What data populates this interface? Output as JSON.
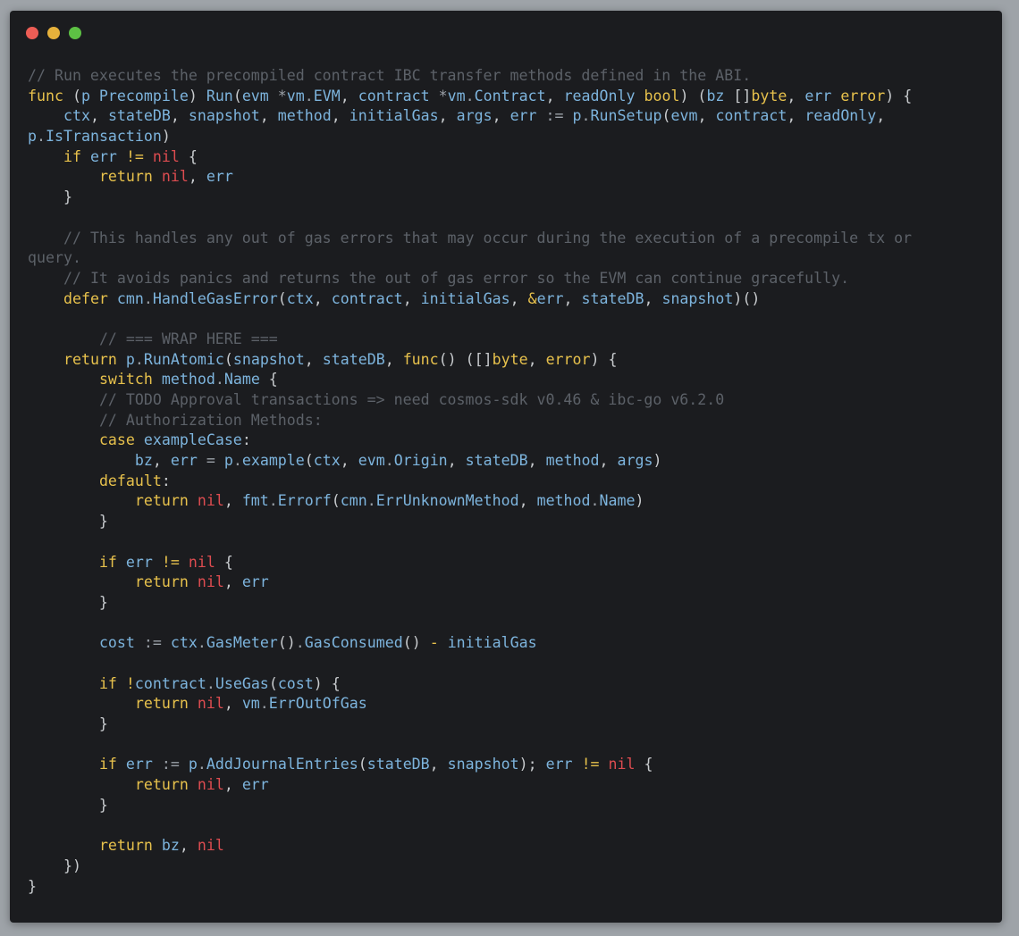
{
  "window": {
    "controls": [
      {
        "name": "close",
        "color": "#ed5d55"
      },
      {
        "name": "minimize",
        "color": "#e6b13b"
      },
      {
        "name": "zoom",
        "color": "#5dc144"
      }
    ]
  },
  "palette": {
    "c": "#5c6168",
    "k": "#e7c14c",
    "i": "#7db4dd",
    "o": "#9ba1a8",
    "n": "#dd4c50",
    "t": "#e7c14c",
    "s": "#c8cbce"
  },
  "code": {
    "lines": [
      [
        [
          "c",
          "// Run executes the precompiled contract IBC transfer methods defined in the ABI."
        ]
      ],
      [
        [
          "k",
          "func"
        ],
        [
          "s",
          " ("
        ],
        [
          "i",
          "p Precompile"
        ],
        [
          "s",
          ") "
        ],
        [
          "i",
          "Run"
        ],
        [
          "s",
          "("
        ],
        [
          "i",
          "evm "
        ],
        [
          "o",
          "*"
        ],
        [
          "i",
          "vm"
        ],
        [
          "o",
          "."
        ],
        [
          "i",
          "EVM"
        ],
        [
          "s",
          ", "
        ],
        [
          "i",
          "contract "
        ],
        [
          "o",
          "*"
        ],
        [
          "i",
          "vm"
        ],
        [
          "o",
          "."
        ],
        [
          "i",
          "Contract"
        ],
        [
          "s",
          ", "
        ],
        [
          "i",
          "readOnly "
        ],
        [
          "k",
          "bool"
        ],
        [
          "s",
          ") ("
        ],
        [
          "i",
          "bz "
        ],
        [
          "s",
          "[]"
        ],
        [
          "k",
          "byte"
        ],
        [
          "s",
          ", "
        ],
        [
          "i",
          "err "
        ],
        [
          "k",
          "error"
        ],
        [
          "s",
          ") {"
        ]
      ],
      [
        [
          "s",
          "    "
        ],
        [
          "i",
          "ctx"
        ],
        [
          "s",
          ", "
        ],
        [
          "i",
          "stateDB"
        ],
        [
          "s",
          ", "
        ],
        [
          "i",
          "snapshot"
        ],
        [
          "s",
          ", "
        ],
        [
          "i",
          "method"
        ],
        [
          "s",
          ", "
        ],
        [
          "i",
          "initialGas"
        ],
        [
          "s",
          ", "
        ],
        [
          "i",
          "args"
        ],
        [
          "s",
          ", "
        ],
        [
          "i",
          "err"
        ],
        [
          "s",
          " "
        ],
        [
          "o",
          ":="
        ],
        [
          "s",
          " "
        ],
        [
          "i",
          "p"
        ],
        [
          "o",
          "."
        ],
        [
          "i",
          "RunSetup"
        ],
        [
          "s",
          "("
        ],
        [
          "i",
          "evm"
        ],
        [
          "s",
          ", "
        ],
        [
          "i",
          "contract"
        ],
        [
          "s",
          ", "
        ],
        [
          "i",
          "readOnly"
        ],
        [
          "s",
          ","
        ]
      ],
      [
        [
          "i",
          "p"
        ],
        [
          "o",
          "."
        ],
        [
          "i",
          "IsTransaction"
        ],
        [
          "s",
          ")"
        ]
      ],
      [
        [
          "s",
          "    "
        ],
        [
          "k",
          "if"
        ],
        [
          "s",
          " "
        ],
        [
          "i",
          "err"
        ],
        [
          "s",
          " "
        ],
        [
          "t",
          "!="
        ],
        [
          "s",
          " "
        ],
        [
          "n",
          "nil"
        ],
        [
          "s",
          " {"
        ]
      ],
      [
        [
          "s",
          "        "
        ],
        [
          "k",
          "return"
        ],
        [
          "s",
          " "
        ],
        [
          "n",
          "nil"
        ],
        [
          "s",
          ", "
        ],
        [
          "i",
          "err"
        ]
      ],
      [
        [
          "s",
          "    }"
        ]
      ],
      [],
      [
        [
          "s",
          "    "
        ],
        [
          "c",
          "// This handles any out of gas errors that may occur during the execution of a precompile tx or"
        ]
      ],
      [
        [
          "c",
          "query."
        ]
      ],
      [
        [
          "s",
          "    "
        ],
        [
          "c",
          "// It avoids panics and returns the out of gas error so the EVM can continue gracefully."
        ]
      ],
      [
        [
          "s",
          "    "
        ],
        [
          "k",
          "defer"
        ],
        [
          "s",
          " "
        ],
        [
          "i",
          "cmn"
        ],
        [
          "o",
          "."
        ],
        [
          "i",
          "HandleGasError"
        ],
        [
          "s",
          "("
        ],
        [
          "i",
          "ctx"
        ],
        [
          "s",
          ", "
        ],
        [
          "i",
          "contract"
        ],
        [
          "s",
          ", "
        ],
        [
          "i",
          "initialGas"
        ],
        [
          "s",
          ", "
        ],
        [
          "t",
          "&"
        ],
        [
          "i",
          "err"
        ],
        [
          "s",
          ", "
        ],
        [
          "i",
          "stateDB"
        ],
        [
          "s",
          ", "
        ],
        [
          "i",
          "snapshot"
        ],
        [
          "s",
          ")()"
        ]
      ],
      [],
      [
        [
          "s",
          "        "
        ],
        [
          "c",
          "// === WRAP HERE ==="
        ]
      ],
      [
        [
          "s",
          "    "
        ],
        [
          "k",
          "return"
        ],
        [
          "s",
          " "
        ],
        [
          "i",
          "p"
        ],
        [
          "o",
          "."
        ],
        [
          "i",
          "RunAtomic"
        ],
        [
          "s",
          "("
        ],
        [
          "i",
          "snapshot"
        ],
        [
          "s",
          ", "
        ],
        [
          "i",
          "stateDB"
        ],
        [
          "s",
          ", "
        ],
        [
          "k",
          "func"
        ],
        [
          "s",
          "() ([]"
        ],
        [
          "k",
          "byte"
        ],
        [
          "s",
          ", "
        ],
        [
          "k",
          "error"
        ],
        [
          "s",
          ") {"
        ]
      ],
      [
        [
          "s",
          "        "
        ],
        [
          "k",
          "switch"
        ],
        [
          "s",
          " "
        ],
        [
          "i",
          "method"
        ],
        [
          "o",
          "."
        ],
        [
          "i",
          "Name"
        ],
        [
          "s",
          " {"
        ]
      ],
      [
        [
          "s",
          "        "
        ],
        [
          "c",
          "// TODO Approval transactions => need cosmos-sdk v0.46 & ibc-go v6.2.0"
        ]
      ],
      [
        [
          "s",
          "        "
        ],
        [
          "c",
          "// Authorization Methods:"
        ]
      ],
      [
        [
          "s",
          "        "
        ],
        [
          "k",
          "case"
        ],
        [
          "s",
          " "
        ],
        [
          "i",
          "exampleCase"
        ],
        [
          "s",
          ":"
        ]
      ],
      [
        [
          "s",
          "            "
        ],
        [
          "i",
          "bz"
        ],
        [
          "s",
          ", "
        ],
        [
          "i",
          "err"
        ],
        [
          "s",
          " "
        ],
        [
          "o",
          "="
        ],
        [
          "s",
          " "
        ],
        [
          "i",
          "p"
        ],
        [
          "o",
          "."
        ],
        [
          "i",
          "example"
        ],
        [
          "s",
          "("
        ],
        [
          "i",
          "ctx"
        ],
        [
          "s",
          ", "
        ],
        [
          "i",
          "evm"
        ],
        [
          "o",
          "."
        ],
        [
          "i",
          "Origin"
        ],
        [
          "s",
          ", "
        ],
        [
          "i",
          "stateDB"
        ],
        [
          "s",
          ", "
        ],
        [
          "i",
          "method"
        ],
        [
          "s",
          ", "
        ],
        [
          "i",
          "args"
        ],
        [
          "s",
          ")"
        ]
      ],
      [
        [
          "s",
          "        "
        ],
        [
          "k",
          "default"
        ],
        [
          "s",
          ":"
        ]
      ],
      [
        [
          "s",
          "            "
        ],
        [
          "k",
          "return"
        ],
        [
          "s",
          " "
        ],
        [
          "n",
          "nil"
        ],
        [
          "s",
          ", "
        ],
        [
          "i",
          "fmt"
        ],
        [
          "o",
          "."
        ],
        [
          "i",
          "Errorf"
        ],
        [
          "s",
          "("
        ],
        [
          "i",
          "cmn"
        ],
        [
          "o",
          "."
        ],
        [
          "i",
          "ErrUnknownMethod"
        ],
        [
          "s",
          ", "
        ],
        [
          "i",
          "method"
        ],
        [
          "o",
          "."
        ],
        [
          "i",
          "Name"
        ],
        [
          "s",
          ")"
        ]
      ],
      [
        [
          "s",
          "        }"
        ]
      ],
      [],
      [
        [
          "s",
          "        "
        ],
        [
          "k",
          "if"
        ],
        [
          "s",
          " "
        ],
        [
          "i",
          "err"
        ],
        [
          "s",
          " "
        ],
        [
          "t",
          "!="
        ],
        [
          "s",
          " "
        ],
        [
          "n",
          "nil"
        ],
        [
          "s",
          " {"
        ]
      ],
      [
        [
          "s",
          "            "
        ],
        [
          "k",
          "return"
        ],
        [
          "s",
          " "
        ],
        [
          "n",
          "nil"
        ],
        [
          "s",
          ", "
        ],
        [
          "i",
          "err"
        ]
      ],
      [
        [
          "s",
          "        }"
        ]
      ],
      [],
      [
        [
          "s",
          "        "
        ],
        [
          "i",
          "cost"
        ],
        [
          "s",
          " "
        ],
        [
          "o",
          ":="
        ],
        [
          "s",
          " "
        ],
        [
          "i",
          "ctx"
        ],
        [
          "o",
          "."
        ],
        [
          "i",
          "GasMeter"
        ],
        [
          "s",
          "()"
        ],
        [
          "o",
          "."
        ],
        [
          "i",
          "GasConsumed"
        ],
        [
          "s",
          "() "
        ],
        [
          "t",
          "-"
        ],
        [
          "s",
          " "
        ],
        [
          "i",
          "initialGas"
        ]
      ],
      [],
      [
        [
          "s",
          "        "
        ],
        [
          "k",
          "if"
        ],
        [
          "s",
          " "
        ],
        [
          "t",
          "!"
        ],
        [
          "i",
          "contract"
        ],
        [
          "o",
          "."
        ],
        [
          "i",
          "UseGas"
        ],
        [
          "s",
          "("
        ],
        [
          "i",
          "cost"
        ],
        [
          "s",
          ") {"
        ]
      ],
      [
        [
          "s",
          "            "
        ],
        [
          "k",
          "return"
        ],
        [
          "s",
          " "
        ],
        [
          "n",
          "nil"
        ],
        [
          "s",
          ", "
        ],
        [
          "i",
          "vm"
        ],
        [
          "o",
          "."
        ],
        [
          "i",
          "ErrOutOfGas"
        ]
      ],
      [
        [
          "s",
          "        }"
        ]
      ],
      [],
      [
        [
          "s",
          "        "
        ],
        [
          "k",
          "if"
        ],
        [
          "s",
          " "
        ],
        [
          "i",
          "err"
        ],
        [
          "s",
          " "
        ],
        [
          "o",
          ":="
        ],
        [
          "s",
          " "
        ],
        [
          "i",
          "p"
        ],
        [
          "o",
          "."
        ],
        [
          "i",
          "AddJournalEntries"
        ],
        [
          "s",
          "("
        ],
        [
          "i",
          "stateDB"
        ],
        [
          "s",
          ", "
        ],
        [
          "i",
          "snapshot"
        ],
        [
          "s",
          "); "
        ],
        [
          "i",
          "err"
        ],
        [
          "s",
          " "
        ],
        [
          "t",
          "!="
        ],
        [
          "s",
          " "
        ],
        [
          "n",
          "nil"
        ],
        [
          "s",
          " {"
        ]
      ],
      [
        [
          "s",
          "            "
        ],
        [
          "k",
          "return"
        ],
        [
          "s",
          " "
        ],
        [
          "n",
          "nil"
        ],
        [
          "s",
          ", "
        ],
        [
          "i",
          "err"
        ]
      ],
      [
        [
          "s",
          "        }"
        ]
      ],
      [],
      [
        [
          "s",
          "        "
        ],
        [
          "k",
          "return"
        ],
        [
          "s",
          " "
        ],
        [
          "i",
          "bz"
        ],
        [
          "s",
          ", "
        ],
        [
          "n",
          "nil"
        ]
      ],
      [
        [
          "s",
          "    })"
        ]
      ],
      [
        [
          "s",
          "}"
        ]
      ]
    ]
  }
}
